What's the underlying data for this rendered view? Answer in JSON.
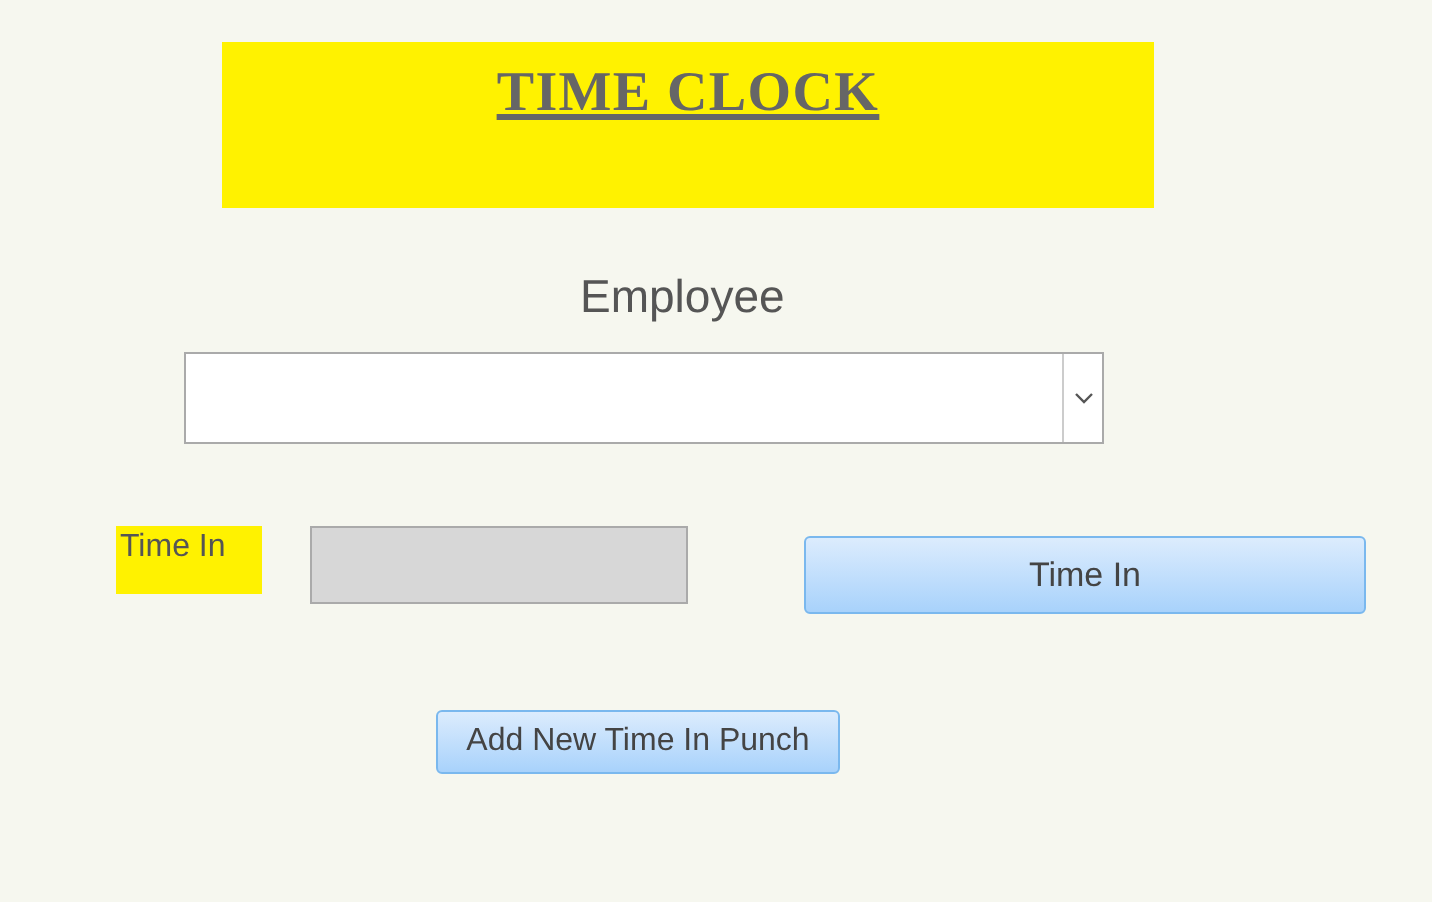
{
  "header": {
    "title": "TIME CLOCK"
  },
  "employee": {
    "label": "Employee"
  },
  "time_in": {
    "label": "Time In",
    "button": "Time In"
  },
  "add_button": "Add New Time In Punch"
}
